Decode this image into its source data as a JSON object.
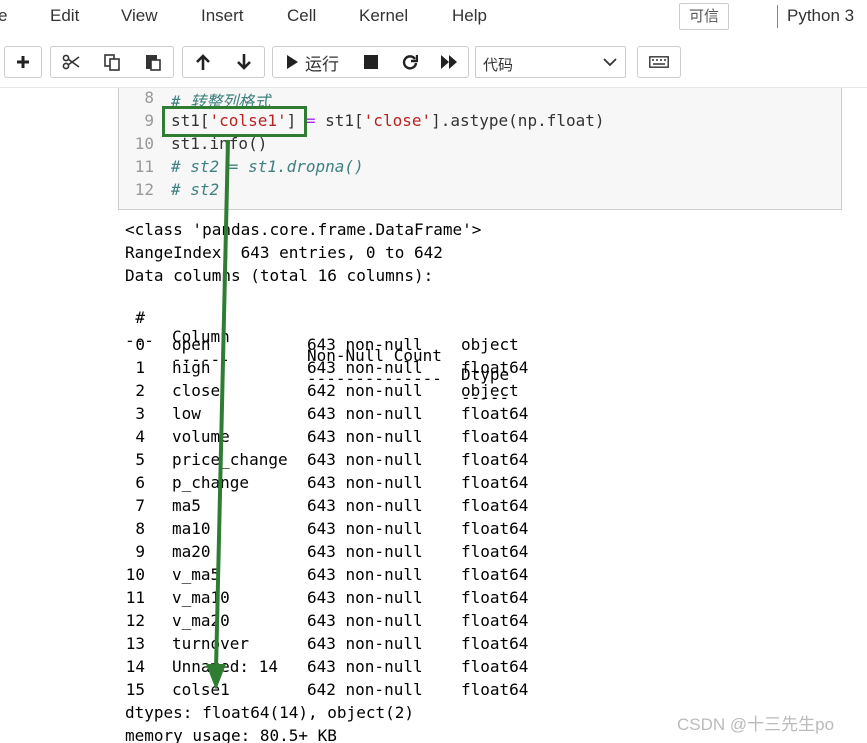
{
  "menubar": {
    "items": [
      "e",
      "Edit",
      "View",
      "Insert",
      "Cell",
      "Kernel",
      "Help"
    ],
    "trusted_label": "可信",
    "kernel_name": "Python 3"
  },
  "toolbar": {
    "run_label": "运行",
    "cell_type": "代码",
    "buttons": [
      "plus-icon",
      "cut-icon",
      "copy-icon",
      "paste-icon",
      "arrow-up-icon",
      "arrow-down-icon",
      "play-icon",
      "stop-icon",
      "restart-icon",
      "fast-forward-icon",
      "keyboard-icon"
    ]
  },
  "code_cell": {
    "lines": [
      {
        "num": "8",
        "text": "# 转整列格式"
      },
      {
        "num": "9",
        "text": "st1['colse1'] = st1['close'].astype(np.float)"
      },
      {
        "num": "10",
        "text": "st1.info()"
      },
      {
        "num": "11",
        "text": "# st2 = st1.dropna()"
      },
      {
        "num": "12",
        "text": "# st2"
      }
    ],
    "line9_parts": [
      "st1[",
      "'colse1'",
      "] ",
      "=",
      " st1[",
      "'close'",
      "].astype(np.float)"
    ]
  },
  "output": {
    "header_lines": [
      "<class 'pandas.core.frame.DataFrame'>",
      "RangeIndex: 643 entries, 0 to 642",
      "Data columns (total 16 columns):"
    ],
    "table_header": {
      "idx": "#",
      "name": "Column",
      "count": "Non-Null Count",
      "dtype": "Dtype"
    },
    "table_rule": {
      "idx": "---",
      "name": "------",
      "count": "--------------",
      "dtype": "-----"
    },
    "rows": [
      {
        "idx": "0",
        "name": "open",
        "count": "643 non-null",
        "dtype": "object"
      },
      {
        "idx": "1",
        "name": "high",
        "count": "643 non-null",
        "dtype": "float64"
      },
      {
        "idx": "2",
        "name": "close",
        "count": "642 non-null",
        "dtype": "object"
      },
      {
        "idx": "3",
        "name": "low",
        "count": "643 non-null",
        "dtype": "float64"
      },
      {
        "idx": "4",
        "name": "volume",
        "count": "643 non-null",
        "dtype": "float64"
      },
      {
        "idx": "5",
        "name": "price_change",
        "count": "643 non-null",
        "dtype": "float64"
      },
      {
        "idx": "6",
        "name": "p_change",
        "count": "643 non-null",
        "dtype": "float64"
      },
      {
        "idx": "7",
        "name": "ma5",
        "count": "643 non-null",
        "dtype": "float64"
      },
      {
        "idx": "8",
        "name": "ma10",
        "count": "643 non-null",
        "dtype": "float64"
      },
      {
        "idx": "9",
        "name": "ma20",
        "count": "643 non-null",
        "dtype": "float64"
      },
      {
        "idx": "10",
        "name": "v_ma5",
        "count": "643 non-null",
        "dtype": "float64"
      },
      {
        "idx": "11",
        "name": "v_ma10",
        "count": "643 non-null",
        "dtype": "float64"
      },
      {
        "idx": "12",
        "name": "v_ma20",
        "count": "643 non-null",
        "dtype": "float64"
      },
      {
        "idx": "13",
        "name": "turnover",
        "count": "643 non-null",
        "dtype": "float64"
      },
      {
        "idx": "14",
        "name": "Unnamed: 14",
        "count": "643 non-null",
        "dtype": "float64"
      },
      {
        "idx": "15",
        "name": "colse1",
        "count": "642 non-null",
        "dtype": "float64"
      }
    ],
    "footer_lines": [
      "dtypes: float64(14), object(2)",
      "memory usage: 80.5+ KB"
    ]
  },
  "annotation": {
    "color": "#2e7d32"
  },
  "watermark": "CSDN @十三先生po"
}
